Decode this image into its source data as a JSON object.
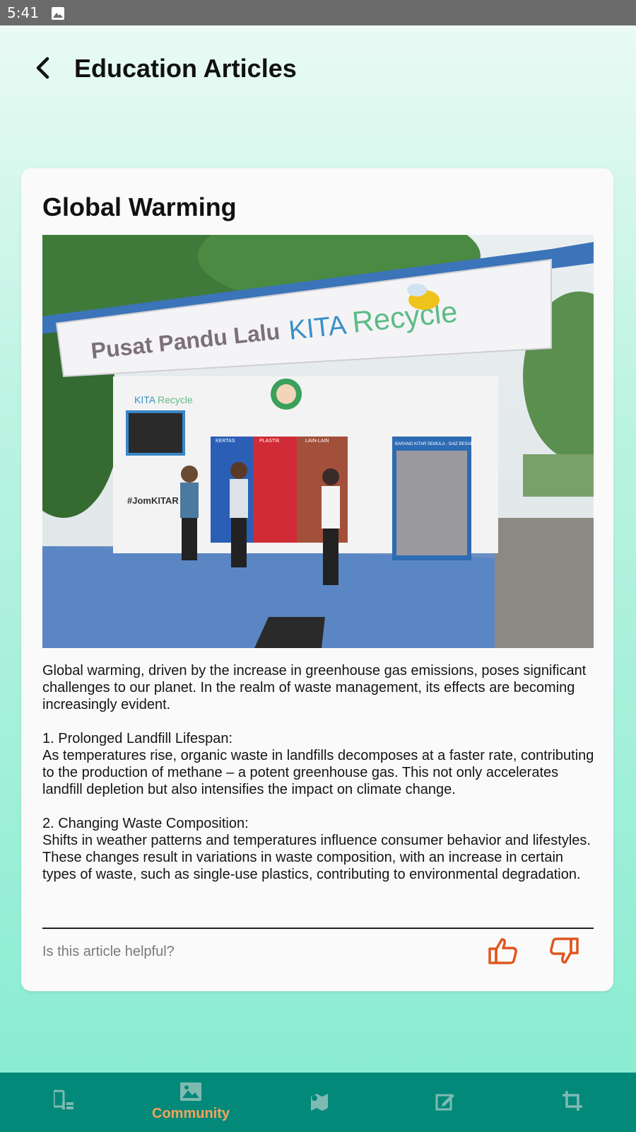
{
  "status_bar": {
    "time": "5:41",
    "icons": [
      "image-icon"
    ]
  },
  "header": {
    "title": "Education Articles",
    "back_icon": "back-arrow-icon"
  },
  "article": {
    "title": "Global Warming",
    "image": {
      "sign_text": "Pusat Pandu Lalu",
      "brand_text_a": "KITA",
      "brand_text_b": "Recycle",
      "small_brand_a": "KITA",
      "small_brand_b": "Recycle",
      "bin_labels": [
        "KERTAS",
        "PLASTIK",
        "LAIN-LAIN"
      ],
      "side_label": "BARANG KITAR SEMULA - SAIZ BESAR",
      "hashtag": "#JomKITAR"
    },
    "body": "Global warming, driven by the increase in greenhouse gas emissions, poses significant challenges to our planet. In the realm of waste management, its effects are becoming increasingly evident.\n\n1. Prolonged Landfill Lifespan:\nAs temperatures rise, organic waste in landfills decomposes at a faster rate, contributing to the production of methane – a potent greenhouse gas. This not only accelerates landfill depletion but also intensifies the impact on climate change.\n\n2. Changing Waste Composition:\nShifts in weather patterns and temperatures influence consumer behavior and lifestyles. These changes result in variations in waste composition, with an increase in certain types of waste, such as single-use plastics, contributing to environmental degradation."
  },
  "feedback": {
    "question": "Is this article helpful?",
    "like_icon": "thumbs-up-icon",
    "dislike_icon": "thumbs-down-icon",
    "accent_color": "#e0561f"
  },
  "bottom_nav": {
    "items": [
      {
        "icon": "checklist-icon",
        "label": "",
        "active": false
      },
      {
        "icon": "image-icon",
        "label": "Community",
        "active": true
      },
      {
        "icon": "map-pin-icon",
        "label": "",
        "active": false
      },
      {
        "icon": "edit-icon",
        "label": "",
        "active": false
      },
      {
        "icon": "crop-icon",
        "label": "",
        "active": false
      }
    ],
    "background": "#03897a",
    "active_color": "#f5a35a"
  }
}
